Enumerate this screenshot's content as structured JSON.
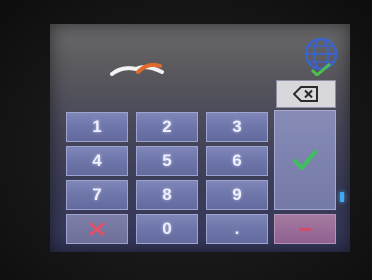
{
  "keypad": {
    "keys": [
      {
        "label": "1"
      },
      {
        "label": "2"
      },
      {
        "label": "3"
      },
      {
        "label": "4"
      },
      {
        "label": "5"
      },
      {
        "label": "6"
      },
      {
        "label": "7"
      },
      {
        "label": "8"
      },
      {
        "label": "9"
      },
      {
        "label": ""
      },
      {
        "label": "0"
      },
      {
        "label": "."
      }
    ]
  },
  "icons": {
    "backspace": "backspace-icon",
    "confirm": "checkmark-icon",
    "cancel": "close-icon",
    "language": "globe-icon",
    "logo": "brand-logo-icon"
  },
  "colors": {
    "key_bg": "#6e75a9",
    "confirm_check": "#3fbf5f",
    "cancel_x": "#e0506a",
    "globe": "#3b63c8"
  }
}
